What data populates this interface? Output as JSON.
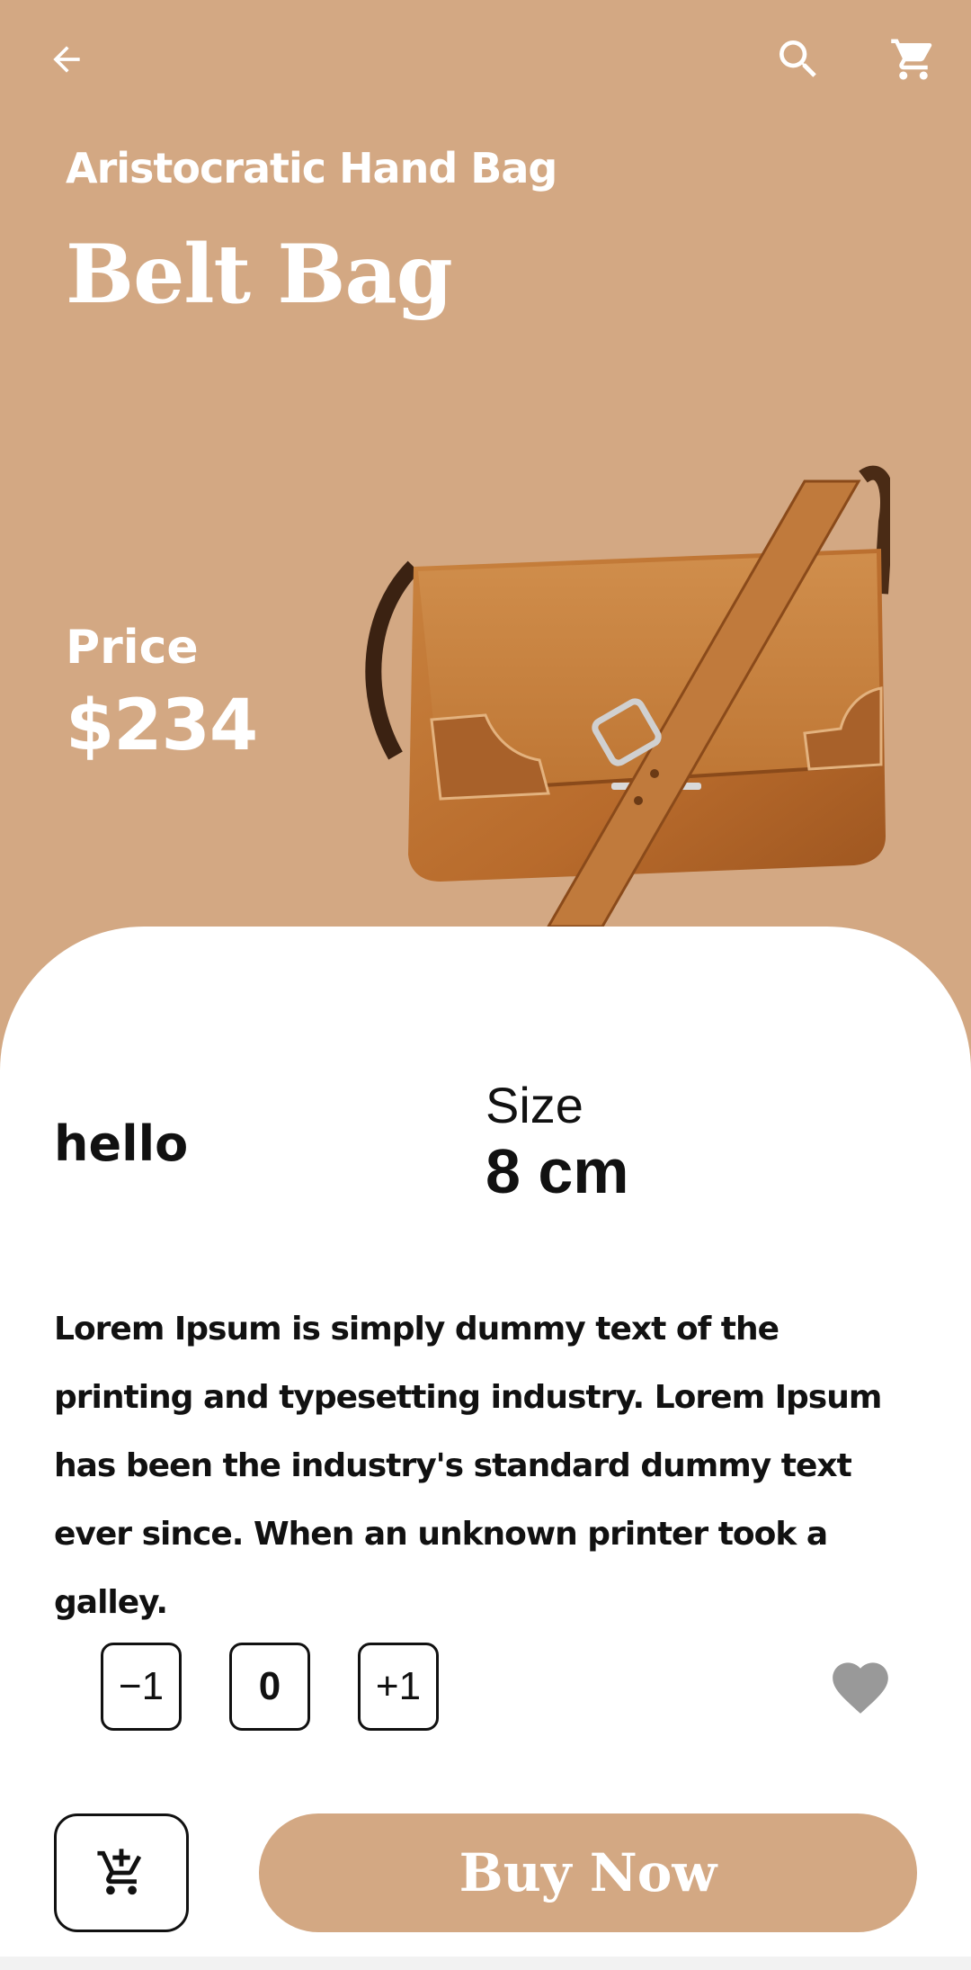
{
  "theme": {
    "accent": "#D3A883",
    "text": "#111111",
    "background": "#ffffff",
    "favorite": "#999999"
  },
  "header": {
    "back_icon": "arrow-left-icon",
    "search_icon": "search-icon",
    "cart_icon": "shopping-cart-icon"
  },
  "product": {
    "subtitle": "Aristocratic Hand Bag",
    "title": "Belt Bag",
    "price_label": "Price",
    "price": "$234",
    "color_value": "hello",
    "size_label": "Size",
    "size_value": "8 cm",
    "description": "Lorem Ipsum is simply dummy text of the printing and typesetting industry. Lorem Ipsum has been the industry's standard dummy text ever since. When an unknown printer took a galley."
  },
  "quantity": {
    "minus_label": "−1",
    "value": "0",
    "plus_label": "+1"
  },
  "actions": {
    "favorite_icon": "heart-icon",
    "add_to_cart_icon": "add-shopping-cart-icon",
    "buy_label": "Buy Now"
  }
}
